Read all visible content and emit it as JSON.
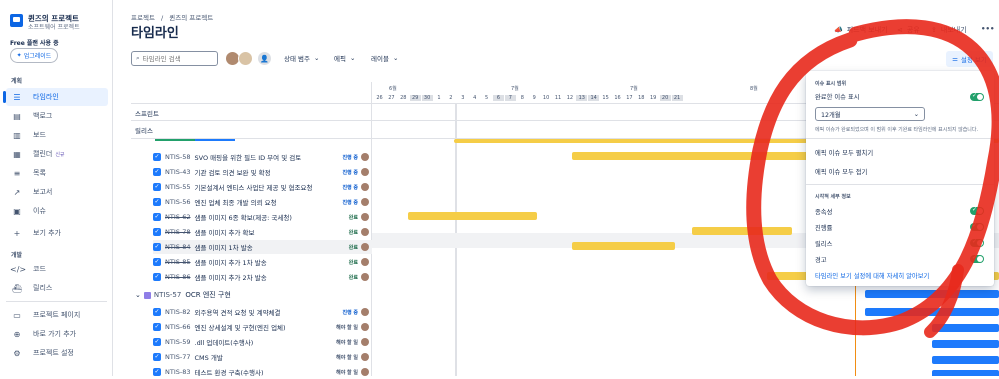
{
  "project": {
    "name": "퀸즈의 프로젝트",
    "type": "소프트웨어 프로젝트"
  },
  "plan": {
    "label": "Free 플랜 사용 중",
    "upgrade": "업그레이드"
  },
  "sidebar": {
    "section_plan": "계획",
    "section_dev": "개발",
    "items": [
      {
        "label": "타임라인",
        "icon": "timeline-icon"
      },
      {
        "label": "백로그",
        "icon": "backlog-icon"
      },
      {
        "label": "보드",
        "icon": "board-icon"
      },
      {
        "label": "캘린더",
        "badge": "신규",
        "icon": "calendar-icon"
      },
      {
        "label": "목록",
        "icon": "list-icon"
      },
      {
        "label": "보고서",
        "icon": "reports-icon"
      },
      {
        "label": "이슈",
        "icon": "issues-icon"
      },
      {
        "label": "보기 추가",
        "icon": "plus-icon"
      },
      {
        "label": "코드",
        "icon": "code-icon"
      },
      {
        "label": "릴리스",
        "icon": "release-icon"
      },
      {
        "label": "프로젝트 페이지",
        "icon": "pages-icon"
      },
      {
        "label": "바로 가기 추가",
        "icon": "shortcut-icon"
      },
      {
        "label": "프로젝트 설정",
        "icon": "settings-icon"
      }
    ]
  },
  "breadcrumb": {
    "root": "프로젝트",
    "sep": "/",
    "current": "퀸즈의 프로젝트"
  },
  "page_title": "타임라인",
  "header_actions": {
    "feedback": "피드백 보내기",
    "share": "공유",
    "export": "내보내기",
    "more": "•••"
  },
  "toolbar": {
    "search_placeholder": "타임라인 검색",
    "status": "상태 범주",
    "epic": "에픽",
    "label": "레이블",
    "view_settings": "설정 보기"
  },
  "grid": {
    "sprint": "스프린트",
    "release": "릴리스",
    "months": [
      "6월",
      "7월",
      "7월",
      "8월"
    ],
    "days": [
      "26",
      "27",
      "28",
      "29",
      "30",
      "1",
      "2",
      "3",
      "4",
      "5",
      "6",
      "7",
      "8",
      "9",
      "10",
      "11",
      "12",
      "13",
      "14",
      "15",
      "16",
      "17",
      "18",
      "19",
      "20",
      "21"
    ]
  },
  "issues": [
    {
      "key": "NTIS-58",
      "summary": "SVO 매핑을 위한 필드 ID 부여 및 검토",
      "status": "진행 중",
      "kind": "prog",
      "done": false
    },
    {
      "key": "NTIS-43",
      "summary": "기관 검토 의견 보완 및 확정",
      "status": "진행 중",
      "kind": "prog",
      "done": false
    },
    {
      "key": "NTIS-55",
      "summary": "기본설계서 엔티스 사업단 제공 및 협조요청",
      "status": "진행 중",
      "kind": "prog",
      "done": false
    },
    {
      "key": "NTIS-56",
      "summary": "엔진 업체 최종 개발 의뢰 요청",
      "status": "진행 중",
      "kind": "prog",
      "done": false
    },
    {
      "key": "NTIS-62",
      "summary": "샘플 이미지 6종 확보(제공: 국세청)",
      "status": "완료",
      "kind": "done",
      "done": true
    },
    {
      "key": "NTIS-78",
      "summary": "샘플 이미지 추가 확보",
      "status": "완료",
      "kind": "done",
      "done": true
    },
    {
      "key": "NTIS-84",
      "summary": "샘플 이미지 1차 발송",
      "status": "완료",
      "kind": "done",
      "done": true
    },
    {
      "key": "NTIS-85",
      "summary": "샘플 이미지 추가 1차 발송",
      "status": "완료",
      "kind": "done",
      "done": true
    },
    {
      "key": "NTIS-86",
      "summary": "샘플 이미지 추가 2차 발송",
      "status": "완료",
      "kind": "done",
      "done": true
    }
  ],
  "epic": {
    "key": "NTIS-57",
    "summary": "OCR 엔진 구현"
  },
  "epic_issues": [
    {
      "key": "NTIS-82",
      "summary": "외주용역 견적 요청 및 계약체결",
      "status": "진행 중",
      "kind": "prog"
    },
    {
      "key": "NTIS-66",
      "summary": "엔진 상세설계 및 구현(엔진 업체)",
      "status": "해야 할 일",
      "kind": "todo"
    },
    {
      "key": "NTIS-59",
      "summary": ".dll 업데이트(수행사)",
      "status": "해야 할 일",
      "kind": "todo"
    },
    {
      "key": "NTIS-77",
      "summary": "CMS 개발",
      "status": "해야 할 일",
      "kind": "todo"
    },
    {
      "key": "NTIS-83",
      "summary": "테스트 환경 구축(수행사)",
      "status": "해야 할 일",
      "kind": "todo"
    }
  ],
  "panel": {
    "section_issue": "이슈 표시 범위",
    "show_done": "완료한 이슈 표시",
    "period": "12개월",
    "period_help": "에픽 이슈가 완료되었으며 이 범위 이후 기완료 타임라인에 표시되지 않습니다.",
    "expand_all": "에픽 이슈 모두 펼치기",
    "collapse_all": "에픽 이슈 모두 접기",
    "section_visual": "시각적 세부 정보",
    "dependency": "종속성",
    "progress": "진행률",
    "release": "릴리스",
    "warning": "경고",
    "learn_more": "타임라인 보기 설정에 대해 자세히 알아보기"
  },
  "colors": {
    "accent": "#0c66e4",
    "bar_yellow": "#f5cd47",
    "bar_blue": "#1d7afc",
    "annotation_red": "#e8291c",
    "toggle_green": "#22a06b"
  }
}
